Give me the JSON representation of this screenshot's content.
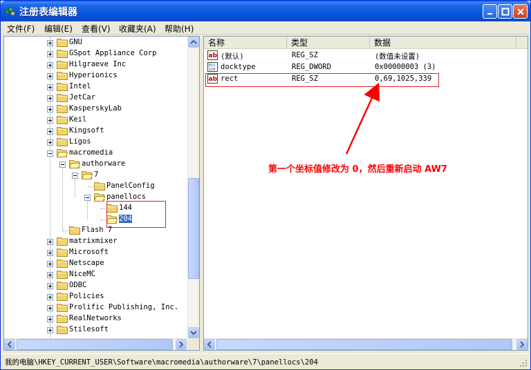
{
  "window": {
    "title": "注册表编辑器"
  },
  "menu": [
    "文件(F)",
    "编辑(E)",
    "查看(V)",
    "收藏夹(A)",
    "帮助(H)"
  ],
  "tree": {
    "items": [
      {
        "label": "GNU",
        "level": 0,
        "expander": "plus"
      },
      {
        "label": "GSpot Appliance Corp",
        "level": 0,
        "expander": "plus"
      },
      {
        "label": "Hilgraeve Inc",
        "level": 0,
        "expander": "plus"
      },
      {
        "label": "Hyperionics",
        "level": 0,
        "expander": "plus"
      },
      {
        "label": "Intel",
        "level": 0,
        "expander": "plus"
      },
      {
        "label": "JetCar",
        "level": 0,
        "expander": "plus"
      },
      {
        "label": "KasperskyLab",
        "level": 0,
        "expander": "plus"
      },
      {
        "label": "Keil",
        "level": 0,
        "expander": "plus"
      },
      {
        "label": "Kingsoft",
        "level": 0,
        "expander": "plus"
      },
      {
        "label": "Ligos",
        "level": 0,
        "expander": "plus"
      },
      {
        "label": "macromedia",
        "level": 0,
        "expander": "minus"
      },
      {
        "label": "authorware",
        "level": 1,
        "expander": "minus"
      },
      {
        "label": "7",
        "level": 2,
        "expander": "minus"
      },
      {
        "label": "PanelConfig",
        "level": 3,
        "expander": "none"
      },
      {
        "label": "panellocs",
        "level": 3,
        "expander": "minus"
      },
      {
        "label": "144",
        "level": 4,
        "expander": "none"
      },
      {
        "label": "204",
        "level": 4,
        "expander": "none",
        "selected": true
      },
      {
        "label": "Flash 7",
        "level": 1,
        "expander": "none"
      },
      {
        "label": "matrixmixer",
        "level": 0,
        "expander": "plus"
      },
      {
        "label": "Microsoft",
        "level": 0,
        "expander": "plus"
      },
      {
        "label": "Netscape",
        "level": 0,
        "expander": "plus"
      },
      {
        "label": "NiceMC",
        "level": 0,
        "expander": "plus"
      },
      {
        "label": "ODBC",
        "level": 0,
        "expander": "plus"
      },
      {
        "label": "Policies",
        "level": 0,
        "expander": "plus"
      },
      {
        "label": "Prolific Publishing, Inc.",
        "level": 0,
        "expander": "plus"
      },
      {
        "label": "RealNetworks",
        "level": 0,
        "expander": "plus"
      },
      {
        "label": "Stilesoft",
        "level": 0,
        "expander": "plus"
      }
    ]
  },
  "list": {
    "columns": [
      "名称",
      "类型",
      "数据"
    ],
    "rows": [
      {
        "icon": "string-value-icon",
        "name": "(默认)",
        "type": "REG_SZ",
        "data": "(数值未设置)"
      },
      {
        "icon": "binary-value-icon",
        "name": "docktype",
        "type": "REG_DWORD",
        "data": "0x00000003 (3)"
      },
      {
        "icon": "string-value-icon",
        "name": "rect",
        "type": "REG_SZ",
        "data": "0,69,1025,339"
      }
    ]
  },
  "annotation": {
    "text": "第一个坐标值修改为 0，然后重新启动 AW7",
    "color": "#ff0000"
  },
  "status": {
    "path": "我的电脑\\HKEY_CURRENT_USER\\Software\\macromedia\\authorware\\7\\panellocs\\204"
  },
  "colors": {
    "titlebar": "#0a55dc",
    "selection": "#316ac5",
    "annotation": "#ff0000"
  }
}
